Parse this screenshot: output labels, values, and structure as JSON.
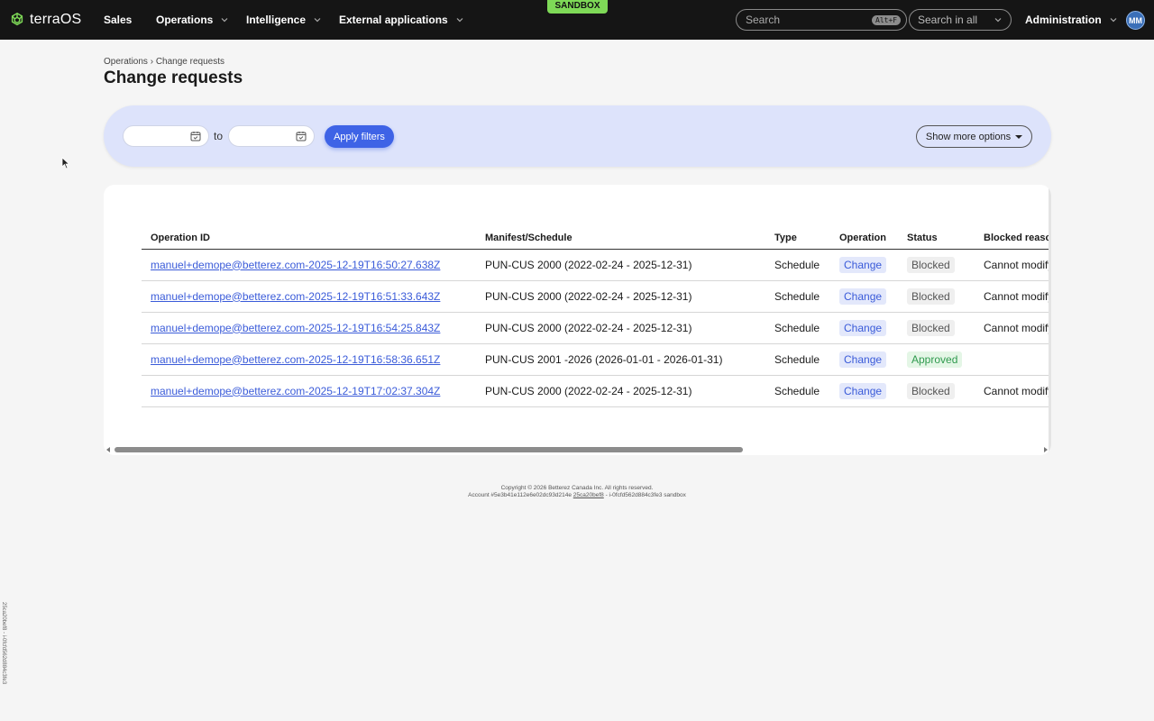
{
  "header": {
    "logo_text": "terraOS",
    "nav": [
      {
        "label": "Sales",
        "has_dropdown": false
      },
      {
        "label": "Operations",
        "has_dropdown": true
      },
      {
        "label": "Intelligence",
        "has_dropdown": true
      },
      {
        "label": "External applications",
        "has_dropdown": true
      }
    ],
    "env_badge": "SANDBOX",
    "search_placeholder": "Search",
    "search_shortcut": "Alt+F",
    "search_scope": "Search in all",
    "admin_label": "Administration",
    "avatar_initials": "MM"
  },
  "breadcrumb": {
    "parent": "Operations",
    "separator": "›",
    "current": "Change requests"
  },
  "page_title": "Change requests",
  "filters": {
    "date_from": "",
    "date_to": "",
    "to_label": "to",
    "apply_label": "Apply filters",
    "more_label": "Show more options"
  },
  "table": {
    "columns": [
      "Operation ID",
      "Manifest/Schedule",
      "Type",
      "Operation",
      "Status",
      "Blocked reason"
    ],
    "rows": [
      {
        "operation_id": "manuel+demope@betterez.com-2025-12-19T16:50:27.638Z",
        "manifest": "PUN-CUS 2000 (2022-02-24 - 2025-12-31)",
        "type": "Schedule",
        "operation": "Change",
        "status": "Blocked",
        "blocked_reason": "Cannot modify"
      },
      {
        "operation_id": "manuel+demope@betterez.com-2025-12-19T16:51:33.643Z",
        "manifest": "PUN-CUS 2000 (2022-02-24 - 2025-12-31)",
        "type": "Schedule",
        "operation": "Change",
        "status": "Blocked",
        "blocked_reason": "Cannot modify"
      },
      {
        "operation_id": "manuel+demope@betterez.com-2025-12-19T16:54:25.843Z",
        "manifest": "PUN-CUS 2000 (2022-02-24 - 2025-12-31)",
        "type": "Schedule",
        "operation": "Change",
        "status": "Blocked",
        "blocked_reason": "Cannot modify"
      },
      {
        "operation_id": "manuel+demope@betterez.com-2025-12-19T16:58:36.651Z",
        "manifest": "PUN-CUS 2001 -2026 (2026-01-01 - 2026-01-31)",
        "type": "Schedule",
        "operation": "Change",
        "status": "Approved",
        "blocked_reason": ""
      },
      {
        "operation_id": "manuel+demope@betterez.com-2025-12-19T17:02:37.304Z",
        "manifest": "PUN-CUS 2000 (2022-02-24 - 2025-12-31)",
        "type": "Schedule",
        "operation": "Change",
        "status": "Blocked",
        "blocked_reason": "Cannot modify"
      }
    ]
  },
  "footer": {
    "copyright": "Copyright © 2026 Betterez Canada Inc. All rights reserved.",
    "account_prefix": "Account #5e3b41e112e6e02dc93d214e",
    "account_link": "25ca20bef8",
    "account_suffix": "- i-0fcfd562d884c3fe3 sandbox"
  },
  "side_id": "25ca20bef8 - i-0fcfd562d884c3fe3",
  "colors": {
    "topbar": "#151515",
    "sandbox_badge": "#7ed957",
    "primary": "#3e63e6",
    "filter_bar": "#dde3fb",
    "approved": "#2f9a4e"
  }
}
